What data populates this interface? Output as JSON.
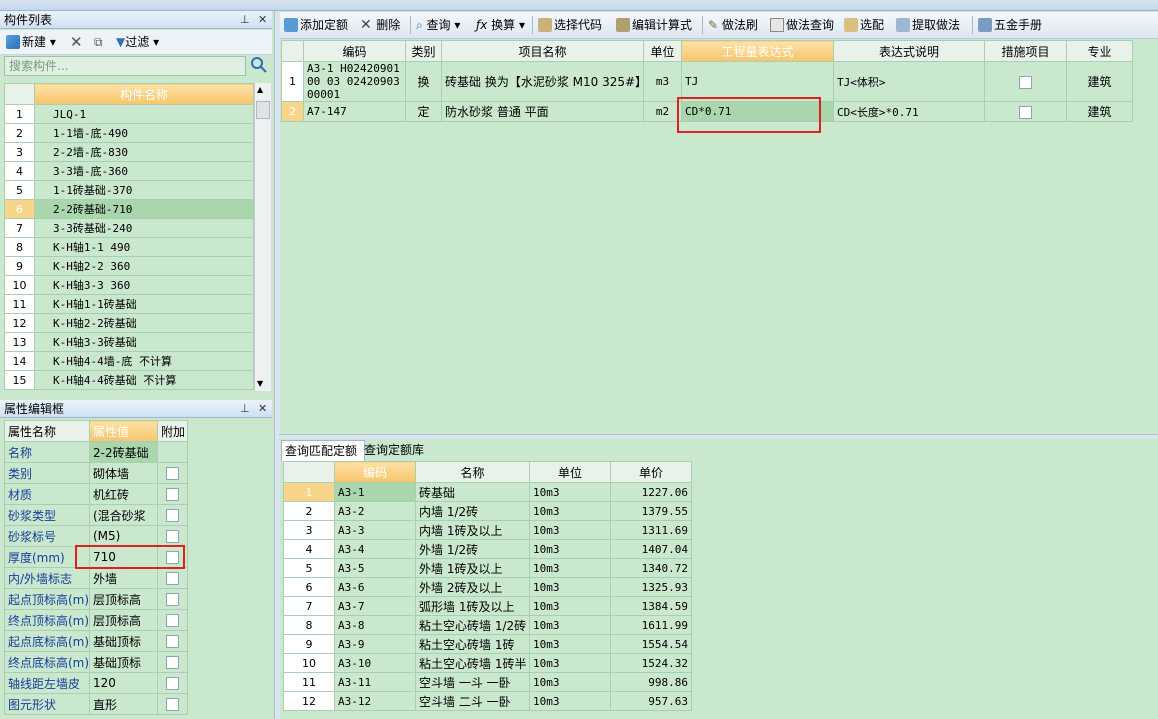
{
  "left_panel": {
    "title": "构件列表",
    "pin": "ᵖ",
    "close": "✕",
    "toolbar": {
      "new_label": "新建",
      "filter_label": "过滤"
    },
    "search_placeholder": "搜索构件...",
    "column_header": "构件名称",
    "selected_index": 6,
    "rows": [
      {
        "n": "1",
        "name": "JLQ-1"
      },
      {
        "n": "2",
        "name": "1-1墙-底-490"
      },
      {
        "n": "3",
        "name": "2-2墙-底-830"
      },
      {
        "n": "4",
        "name": "3-3墙-底-360"
      },
      {
        "n": "5",
        "name": "1-1砖基础-370"
      },
      {
        "n": "6",
        "name": "2-2砖基础-710"
      },
      {
        "n": "7",
        "name": "3-3砖基础-240"
      },
      {
        "n": "8",
        "name": "K-H轴1-1 490"
      },
      {
        "n": "9",
        "name": "K-H轴2-2 360"
      },
      {
        "n": "10",
        "name": "K-H轴3-3 360"
      },
      {
        "n": "11",
        "name": "K-H轴1-1砖基础"
      },
      {
        "n": "12",
        "name": "K-H轴2-2砖基础"
      },
      {
        "n": "13",
        "name": "K-H轴3-3砖基础"
      },
      {
        "n": "14",
        "name": "K-H轴4-4墙-底 不计算"
      },
      {
        "n": "15",
        "name": "K-H轴4-4砖基础 不计算"
      }
    ]
  },
  "prop_panel": {
    "title": "属性编辑框",
    "headers": {
      "name": "属性名称",
      "value": "属性值",
      "extra": "附加"
    },
    "rows": [
      {
        "name": "名称",
        "value": "2-2砖基础"
      },
      {
        "name": "类别",
        "value": "砌体墙"
      },
      {
        "name": "材质",
        "value": "机红砖"
      },
      {
        "name": "砂浆类型",
        "value": "(混合砂浆"
      },
      {
        "name": "砂浆标号",
        "value": "(M5)"
      },
      {
        "name": "厚度(mm)",
        "value": "710"
      },
      {
        "name": "内/外墙标志",
        "value": "外墙"
      },
      {
        "name": "起点顶标高(m)",
        "value": "层顶标高"
      },
      {
        "name": "终点顶标高(m)",
        "value": "层顶标高"
      },
      {
        "name": "起点底标高(m)",
        "value": "基础顶标"
      },
      {
        "name": "终点底标高(m)",
        "value": "基础顶标"
      },
      {
        "name": "轴线距左墙皮",
        "value": "120"
      },
      {
        "name": "图元形状",
        "value": "直形"
      }
    ]
  },
  "main_toolbar": {
    "add_quota": "添加定额",
    "delete": "删除",
    "query": "查询",
    "convert": "换算",
    "select_code": "选择代码",
    "edit_formula": "编辑计算式",
    "method_brush": "做法刷",
    "method_query": "做法查询",
    "select_match": "选配",
    "extract_method": "提取做法",
    "hardware_manual": "五金手册"
  },
  "quota_table": {
    "headers": [
      "编码",
      "类别",
      "项目名称",
      "单位",
      "工程量表达式",
      "表达式说明",
      "措施项目",
      "专业"
    ],
    "rows": [
      {
        "n": "1",
        "code": "A3-1 H0242090100 03 0242090300001",
        "type": "换",
        "name": "砖基础 换为【水泥砂浆 M10 325#】",
        "unit": "m3",
        "expr": "TJ",
        "desc": "TJ<体积>",
        "major": "建筑"
      },
      {
        "n": "2",
        "code": "A7-147",
        "type": "定",
        "name": "防水砂浆 普通 平面",
        "unit": "m2",
        "expr": "CD*0.71",
        "desc": "CD<长度>*0.71",
        "major": "建筑"
      }
    ]
  },
  "bottom_tabs": [
    "查询匹配定额",
    "查询定额库"
  ],
  "match_table": {
    "headers": [
      "编码",
      "名称",
      "单位",
      "单价"
    ],
    "rows": [
      {
        "n": "1",
        "code": "A3-1",
        "name": "砖基础",
        "unit": "10m3",
        "price": "1227.06"
      },
      {
        "n": "2",
        "code": "A3-2",
        "name": "内墙 1/2砖",
        "unit": "10m3",
        "price": "1379.55"
      },
      {
        "n": "3",
        "code": "A3-3",
        "name": "内墙 1砖及以上",
        "unit": "10m3",
        "price": "1311.69"
      },
      {
        "n": "4",
        "code": "A3-4",
        "name": "外墙 1/2砖",
        "unit": "10m3",
        "price": "1407.04"
      },
      {
        "n": "5",
        "code": "A3-5",
        "name": "外墙 1砖及以上",
        "unit": "10m3",
        "price": "1340.72"
      },
      {
        "n": "6",
        "code": "A3-6",
        "name": "外墙 2砖及以上",
        "unit": "10m3",
        "price": "1325.93"
      },
      {
        "n": "7",
        "code": "A3-7",
        "name": "弧形墙 1砖及以上",
        "unit": "10m3",
        "price": "1384.59"
      },
      {
        "n": "8",
        "code": "A3-8",
        "name": "粘土空心砖墙 1/2砖",
        "unit": "10m3",
        "price": "1611.99"
      },
      {
        "n": "9",
        "code": "A3-9",
        "name": "粘土空心砖墙 1砖",
        "unit": "10m3",
        "price": "1554.54"
      },
      {
        "n": "10",
        "code": "A3-10",
        "name": "粘土空心砖墙 1砖半",
        "unit": "10m3",
        "price": "1524.32"
      },
      {
        "n": "11",
        "code": "A3-11",
        "name": "空斗墙 一斗 一卧",
        "unit": "10m3",
        "price": "998.86"
      },
      {
        "n": "12",
        "code": "A3-12",
        "name": "空斗墙 二斗 一卧",
        "unit": "10m3",
        "price": "957.63"
      }
    ]
  }
}
